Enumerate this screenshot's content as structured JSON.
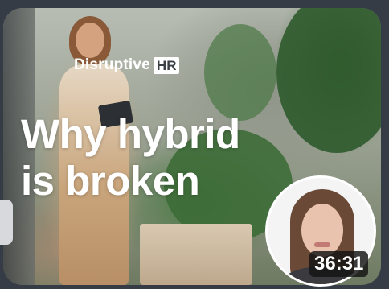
{
  "thumbnail": {
    "brand": {
      "name": "Disruptive",
      "badge": "HR"
    },
    "headline": {
      "line1": "Why hybrid",
      "line2": "is broken"
    },
    "duration": "36:31",
    "icons": {
      "presenter": "presenter-avatar"
    }
  }
}
